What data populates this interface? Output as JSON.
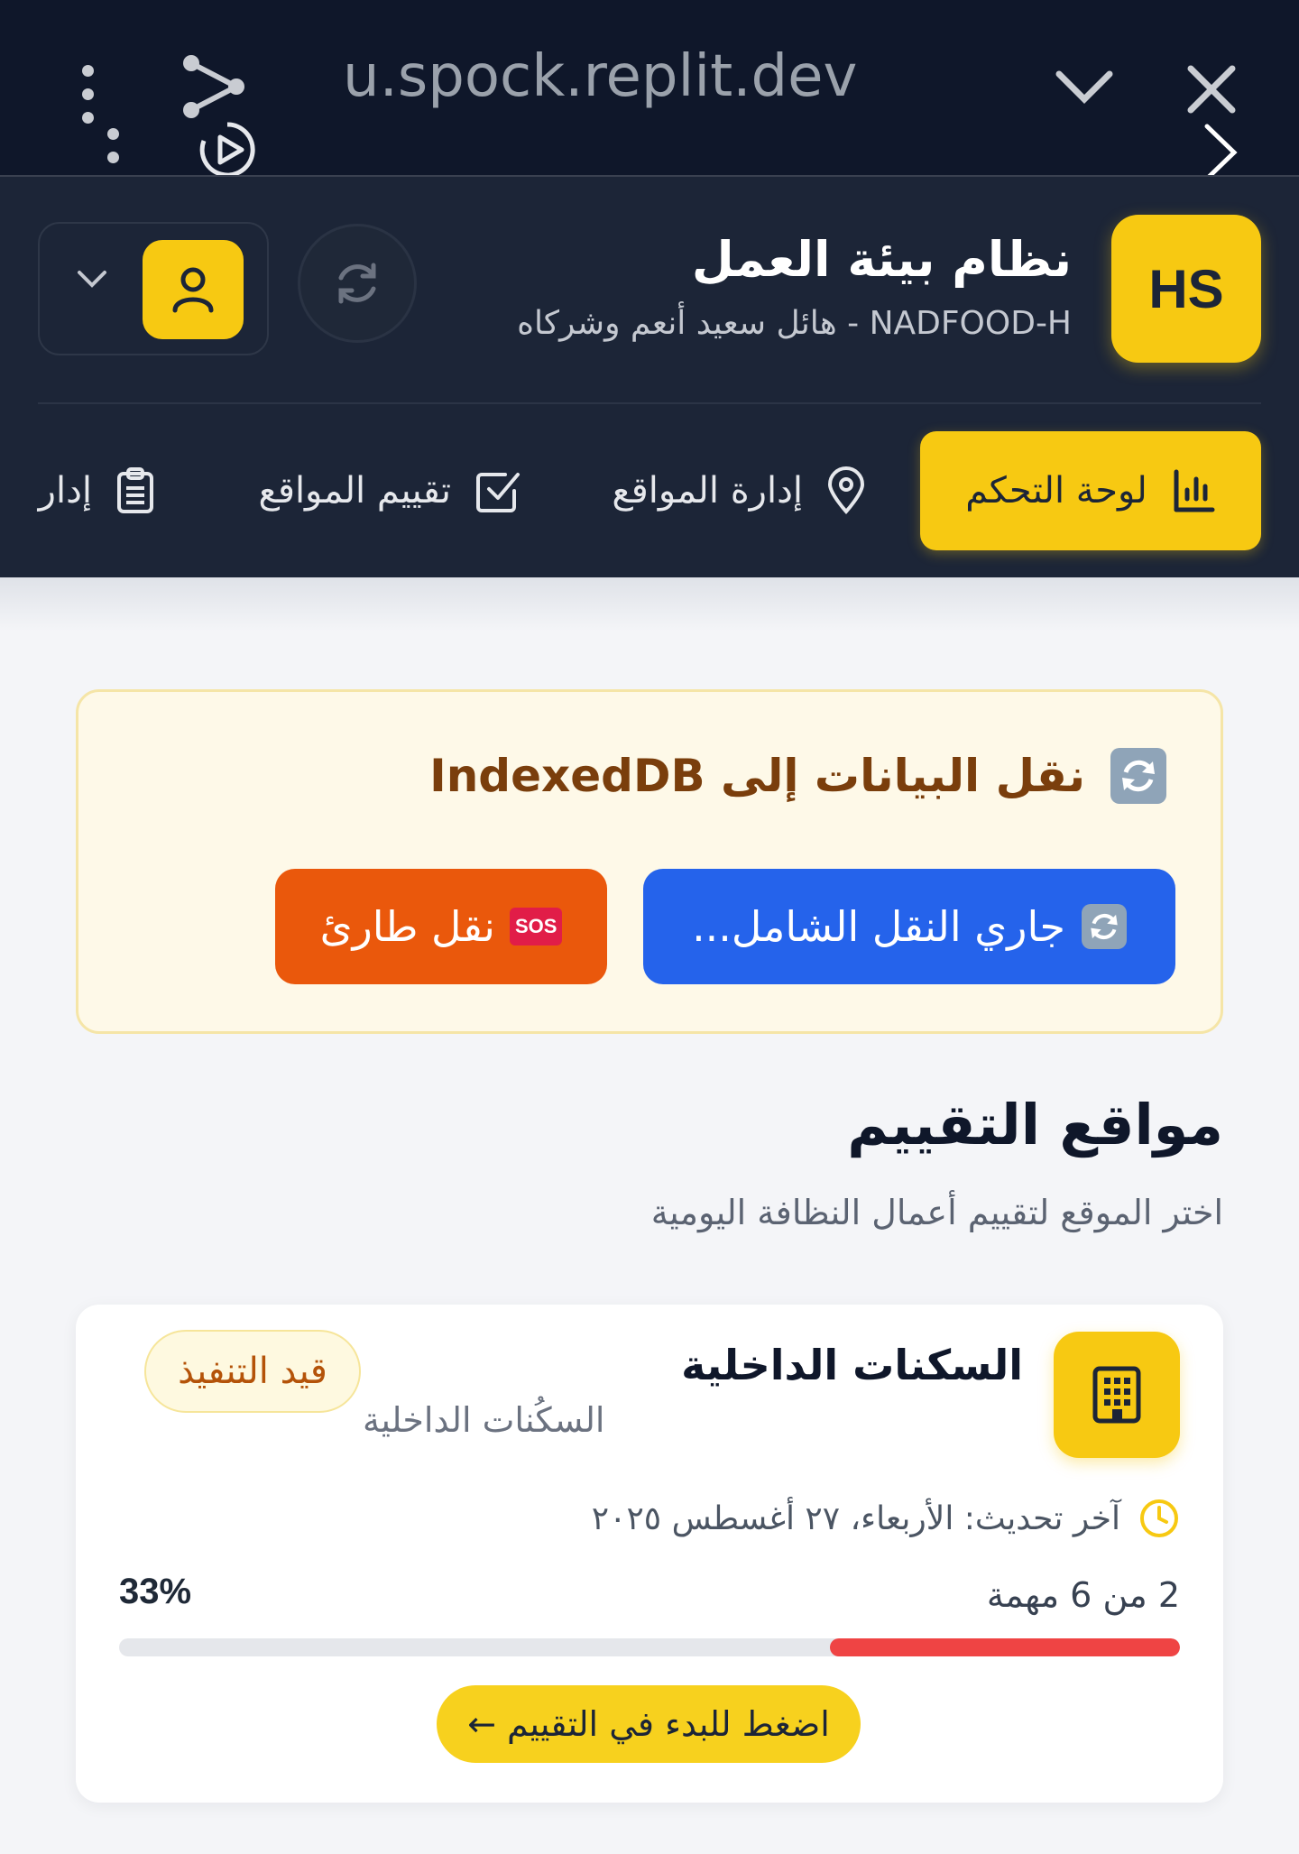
{
  "browser": {
    "url": "u.spock.replit.dev"
  },
  "header": {
    "logo_text": "HS",
    "title": "نظام بيئة العمل",
    "subtitle": "NADFOOD-H - هائل سعيد أنعم وشركاه"
  },
  "nav": {
    "items": [
      {
        "label": "لوحة التحكم",
        "icon": "bar-chart-icon",
        "active": true
      },
      {
        "label": "إدارة المواقع",
        "icon": "map-pin-icon",
        "active": false
      },
      {
        "label": "تقييم المواقع",
        "icon": "check-square-icon",
        "active": false
      },
      {
        "label": "إدار",
        "icon": "clipboard-icon",
        "active": false
      }
    ]
  },
  "migration": {
    "title": "نقل البيانات إلى IndexedDB",
    "primary_label": "جاري النقل الشامل...",
    "emergency_label": "نقل طارئ",
    "sos_text": "SOS"
  },
  "section": {
    "title": "مواقع التقييم",
    "subtitle": "اختر الموقع لتقييم أعمال النظافة اليومية"
  },
  "location": {
    "name": "السكنات الداخلية",
    "subname": "السكُنات الداخلية",
    "status": "قيد التنفيذ",
    "updated": "آخر تحديث: الأربعاء، ٢٧ أغسطس ٢٠٢٥",
    "tasks": "2 من 6 مهمة",
    "percent_label": "33%",
    "progress": 0.33,
    "start_label": "اضغط للبدء في التقييم ←"
  },
  "colors": {
    "accent": "#f7c912",
    "header_bg": "#1c2537",
    "primary_blue": "#2563eb",
    "emergency_orange": "#ea580c",
    "progress_red": "#ef4444"
  }
}
